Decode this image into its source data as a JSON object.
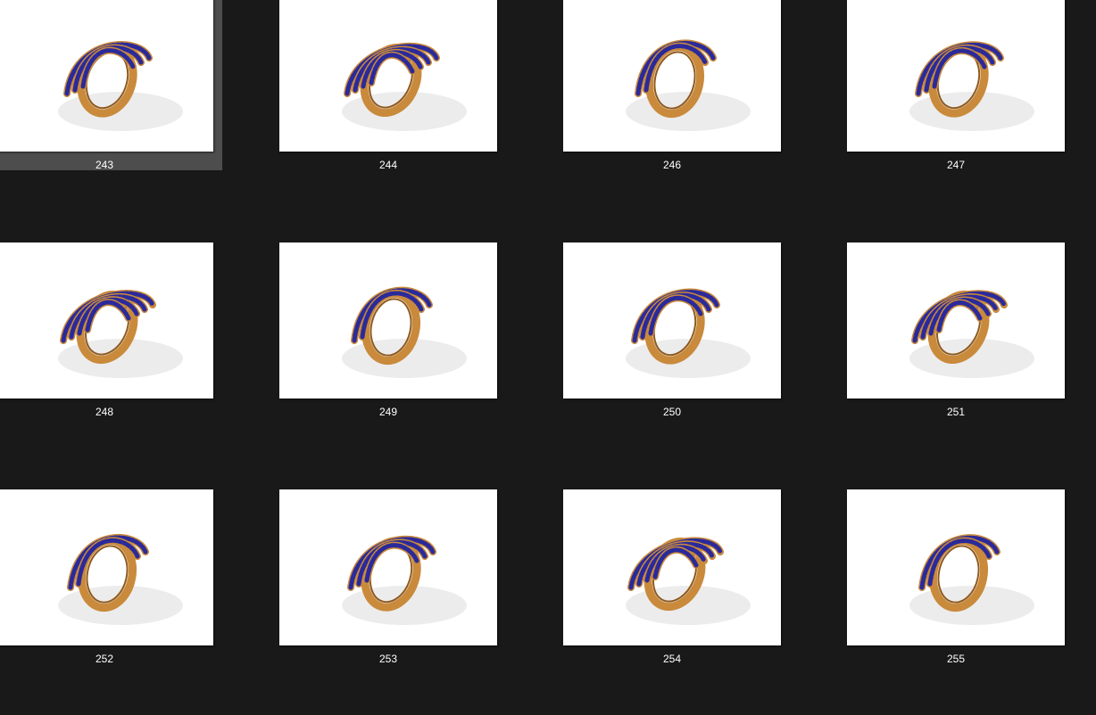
{
  "gallery": {
    "selected_index": 0,
    "items": [
      {
        "label": "243",
        "image": "gold-ring-with-blue-sapphire-pave-icon"
      },
      {
        "label": "244",
        "image": "gold-ring-with-blue-sapphire-pave-icon"
      },
      {
        "label": "246",
        "image": "gold-ring-with-blue-sapphire-pave-icon"
      },
      {
        "label": "247",
        "image": "gold-ring-with-blue-sapphire-pave-icon"
      },
      {
        "label": "248",
        "image": "gold-ring-with-blue-sapphire-pave-icon"
      },
      {
        "label": "249",
        "image": "gold-ring-with-blue-sapphire-pave-icon"
      },
      {
        "label": "250",
        "image": "gold-ring-with-blue-sapphire-pave-icon"
      },
      {
        "label": "251",
        "image": "gold-ring-with-blue-sapphire-pave-icon"
      },
      {
        "label": "252",
        "image": "gold-ring-with-blue-sapphire-pave-icon"
      },
      {
        "label": "253",
        "image": "gold-ring-with-blue-sapphire-pave-icon"
      },
      {
        "label": "254",
        "image": "gold-ring-with-blue-sapphire-pave-icon"
      },
      {
        "label": "255",
        "image": "gold-ring-with-blue-sapphire-pave-icon"
      }
    ]
  },
  "colors": {
    "background": "#191919",
    "selection": "#4d4d4d",
    "thumbnail_bg": "#ffffff",
    "caption_text": "#ffffff",
    "gold": "#c98a3c",
    "gold_dark": "#8f5a1f",
    "sapphire": "#2b2a9a"
  }
}
